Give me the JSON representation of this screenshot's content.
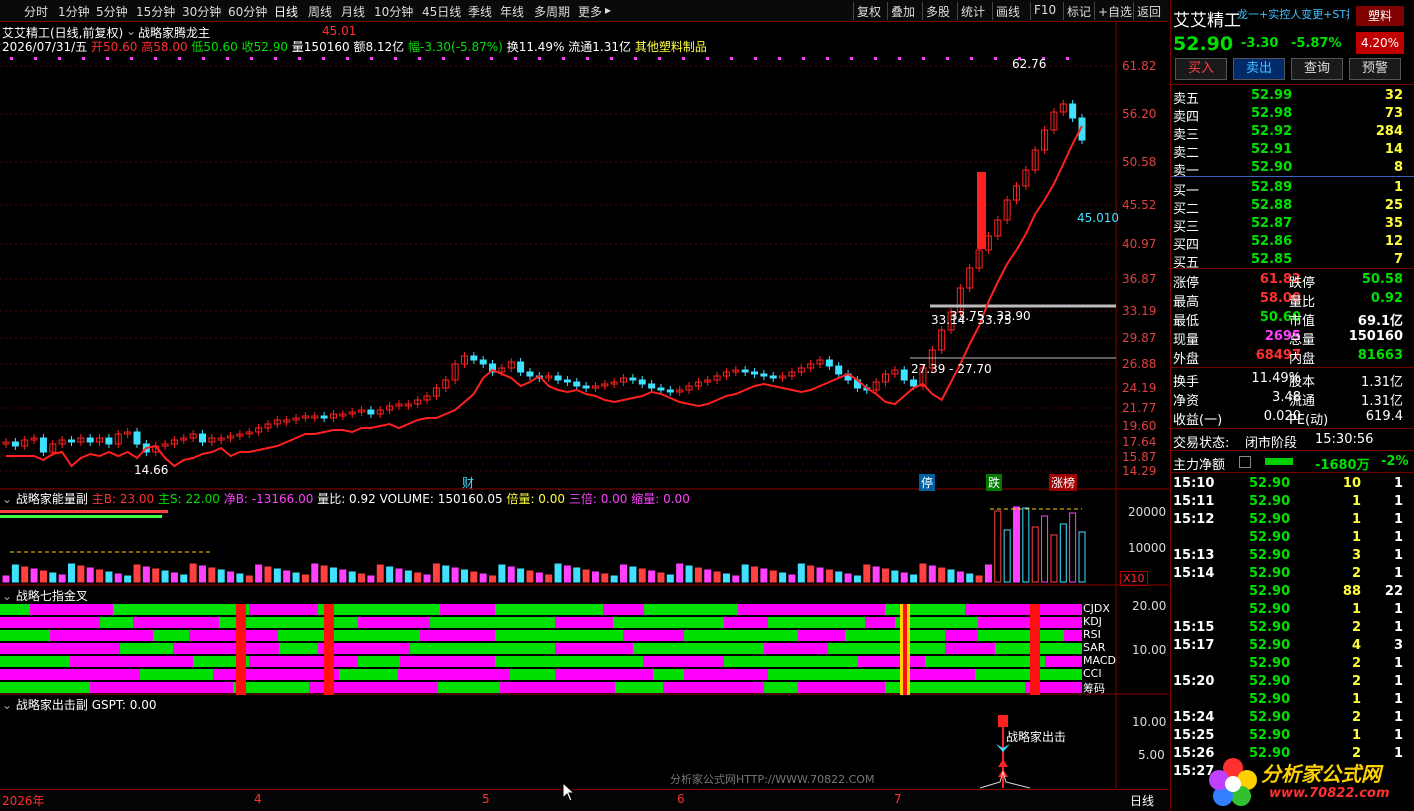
{
  "toolbar": {
    "periods": [
      "分时",
      "1分钟",
      "5分钟",
      "15分钟",
      "30分钟",
      "60分钟",
      "日线",
      "周线",
      "月线",
      "10分钟",
      "45日线",
      "季线",
      "年线",
      "多周期",
      "更多"
    ],
    "tools": [
      "复权",
      "叠加",
      "多股",
      "统计",
      "画线",
      "F10",
      "标记",
      "+自选",
      "返回"
    ],
    "active_period": "日线"
  },
  "chart": {
    "title": "艾艾精工(日线,前复权)",
    "indicator": "战略家腾龙主",
    "indicator_value": "45.01",
    "ohlc_line": {
      "date": "2026/07/31/五",
      "open": "开50.60",
      "high": "高58.00",
      "low": "低50.60",
      "close": "收52.90",
      "volume": "量150160",
      "amount": "额8.12亿",
      "change": "幅-3.30(-5.87%)",
      "turnover": "换11.49%",
      "float": "流通1.31亿",
      "sector": "其他塑料制品"
    },
    "price_axis": [
      "61.82",
      "56.20",
      "50.58",
      "45.52",
      "40.97",
      "36.87",
      "33.19",
      "29.87",
      "26.88",
      "24.19",
      "21.77",
      "19.60",
      "17.64",
      "15.87",
      "14.29"
    ],
    "annotations": {
      "peak": "62.76",
      "low_label": "14.66",
      "range1": "27.39 - 27.70",
      "range2": "33.14 - 33.75",
      "range3": "33.75 - 33.90",
      "ma_value": "45.010"
    },
    "events": [
      "财",
      "停",
      "跌",
      "涨榜"
    ]
  },
  "sub1": {
    "title": "战略家能量副",
    "main_b": "主B: 23.00",
    "main_s": "主S: 22.00",
    "net_b": "净B: -13166.00",
    "vol_ratio": "量比: 0.92",
    "volume": "VOLUME: 150160.05",
    "double": "倍量: 0.00",
    "triple": "三倍: 0.00",
    "shrink": "缩量: 0.00",
    "axis": [
      "20000",
      "10000"
    ],
    "multiplier": "X10"
  },
  "sub2": {
    "title": "战略七指金叉",
    "axis": [
      "20.00",
      "10.00"
    ],
    "rows": [
      "CJDX",
      "KDJ",
      "RSI",
      "SAR",
      "MACD",
      "CCI",
      "筹码"
    ]
  },
  "sub3": {
    "title": "战略家出击副",
    "value": "GSPT: 0.00",
    "axis": [
      "10.00",
      "5.00"
    ],
    "signal": "战略家出击",
    "watermark": "分析家公式网HTTP://WWW.70822.COM"
  },
  "timeline": {
    "labels": [
      "2026年",
      "4",
      "5",
      "6",
      "7"
    ],
    "mode": "日线"
  },
  "quote": {
    "name": "艾艾精工",
    "scroll_text": "龙一+实控人变更+ST摘",
    "tag": "塑料",
    "price": "52.90",
    "change": "-3.30",
    "pct": "-5.87%",
    "range_pct": "4.20%",
    "buttons": [
      "买入",
      "卖出",
      "查询",
      "预警"
    ],
    "asks": [
      {
        "label": "卖五",
        "price": "52.99",
        "vol": "32"
      },
      {
        "label": "卖四",
        "price": "52.98",
        "vol": "73"
      },
      {
        "label": "卖三",
        "price": "52.92",
        "vol": "284"
      },
      {
        "label": "卖二",
        "price": "52.91",
        "vol": "14"
      },
      {
        "label": "卖一",
        "price": "52.90",
        "vol": "8"
      }
    ],
    "bids": [
      {
        "label": "买一",
        "price": "52.89",
        "vol": "1"
      },
      {
        "label": "买二",
        "price": "52.88",
        "vol": "25"
      },
      {
        "label": "买三",
        "price": "52.87",
        "vol": "35"
      },
      {
        "label": "买四",
        "price": "52.86",
        "vol": "12"
      },
      {
        "label": "买五",
        "price": "52.85",
        "vol": "7"
      }
    ],
    "stats": [
      {
        "l1": "涨停",
        "v1": "61.82",
        "c1": "red",
        "l2": "跌停",
        "v2": "50.58",
        "c2": "green"
      },
      {
        "l1": "最高",
        "v1": "58.00",
        "c1": "red",
        "l2": "量比",
        "v2": "0.92",
        "c2": "green"
      },
      {
        "l1": "最低",
        "v1": "50.60",
        "c1": "green",
        "l2": "市值",
        "v2": "69.1亿",
        "c2": "white"
      },
      {
        "l1": "现量",
        "v1": "2695",
        "c1": "magenta",
        "l2": "总量",
        "v2": "150160",
        "c2": "white"
      },
      {
        "l1": "外盘",
        "v1": "68497",
        "c1": "red",
        "l2": "内盘",
        "v2": "81663",
        "c2": "green"
      }
    ],
    "stats2": [
      {
        "l1": "换手",
        "v1": "11.49%",
        "l2": "股本",
        "v2": "1.31亿"
      },
      {
        "l1": "净资",
        "v1": "3.48",
        "l2": "流通",
        "v2": "1.31亿"
      },
      {
        "l1": "收益(一)",
        "v1": "0.020",
        "l2": "PE(动)",
        "v2": "619.4"
      }
    ],
    "trade_state_label": "交易状态:",
    "trade_state": "闭市阶段",
    "trade_time": "15:30:56",
    "net_label": "主力净额",
    "net_value": "-1680万",
    "net_pct": "-2%",
    "ticks": [
      {
        "t": "15:10",
        "p": "52.90",
        "v": "10",
        "n": "1",
        "vc": "yellow"
      },
      {
        "t": "15:11",
        "p": "52.90",
        "v": "1",
        "n": "1",
        "vc": "yellow"
      },
      {
        "t": "15:12",
        "p": "52.90",
        "v": "1",
        "n": "1",
        "vc": "yellow"
      },
      {
        "t": "",
        "p": "52.90",
        "v": "1",
        "n": "1",
        "vc": "yellow"
      },
      {
        "t": "15:13",
        "p": "52.90",
        "v": "3",
        "n": "1",
        "vc": "yellow"
      },
      {
        "t": "15:14",
        "p": "52.90",
        "v": "2",
        "n": "1",
        "vc": "yellow"
      },
      {
        "t": "",
        "p": "52.90",
        "v": "88",
        "n": "22",
        "vc": "yellow"
      },
      {
        "t": "",
        "p": "52.90",
        "v": "1",
        "n": "1",
        "vc": "yellow"
      },
      {
        "t": "15:15",
        "p": "52.90",
        "v": "2",
        "n": "1",
        "vc": "yellow"
      },
      {
        "t": "15:17",
        "p": "52.90",
        "v": "4",
        "n": "3",
        "vc": "yellow"
      },
      {
        "t": "",
        "p": "52.90",
        "v": "2",
        "n": "1",
        "vc": "yellow"
      },
      {
        "t": "15:20",
        "p": "52.90",
        "v": "2",
        "n": "1",
        "vc": "yellow"
      },
      {
        "t": "",
        "p": "52.90",
        "v": "1",
        "n": "1",
        "vc": "yellow"
      },
      {
        "t": "15:24",
        "p": "52.90",
        "v": "2",
        "n": "1",
        "vc": "yellow"
      },
      {
        "t": "15:25",
        "p": "52.90",
        "v": "1",
        "n": "1",
        "vc": "yellow"
      },
      {
        "t": "15:26",
        "p": "52.90",
        "v": "2",
        "n": "1",
        "vc": "yellow"
      },
      {
        "t": "15:27",
        "p": "",
        "v": "",
        "n": "",
        "vc": "yellow"
      }
    ],
    "logo_text": "分析家公式网",
    "logo_url": "www.70822.com"
  }
}
